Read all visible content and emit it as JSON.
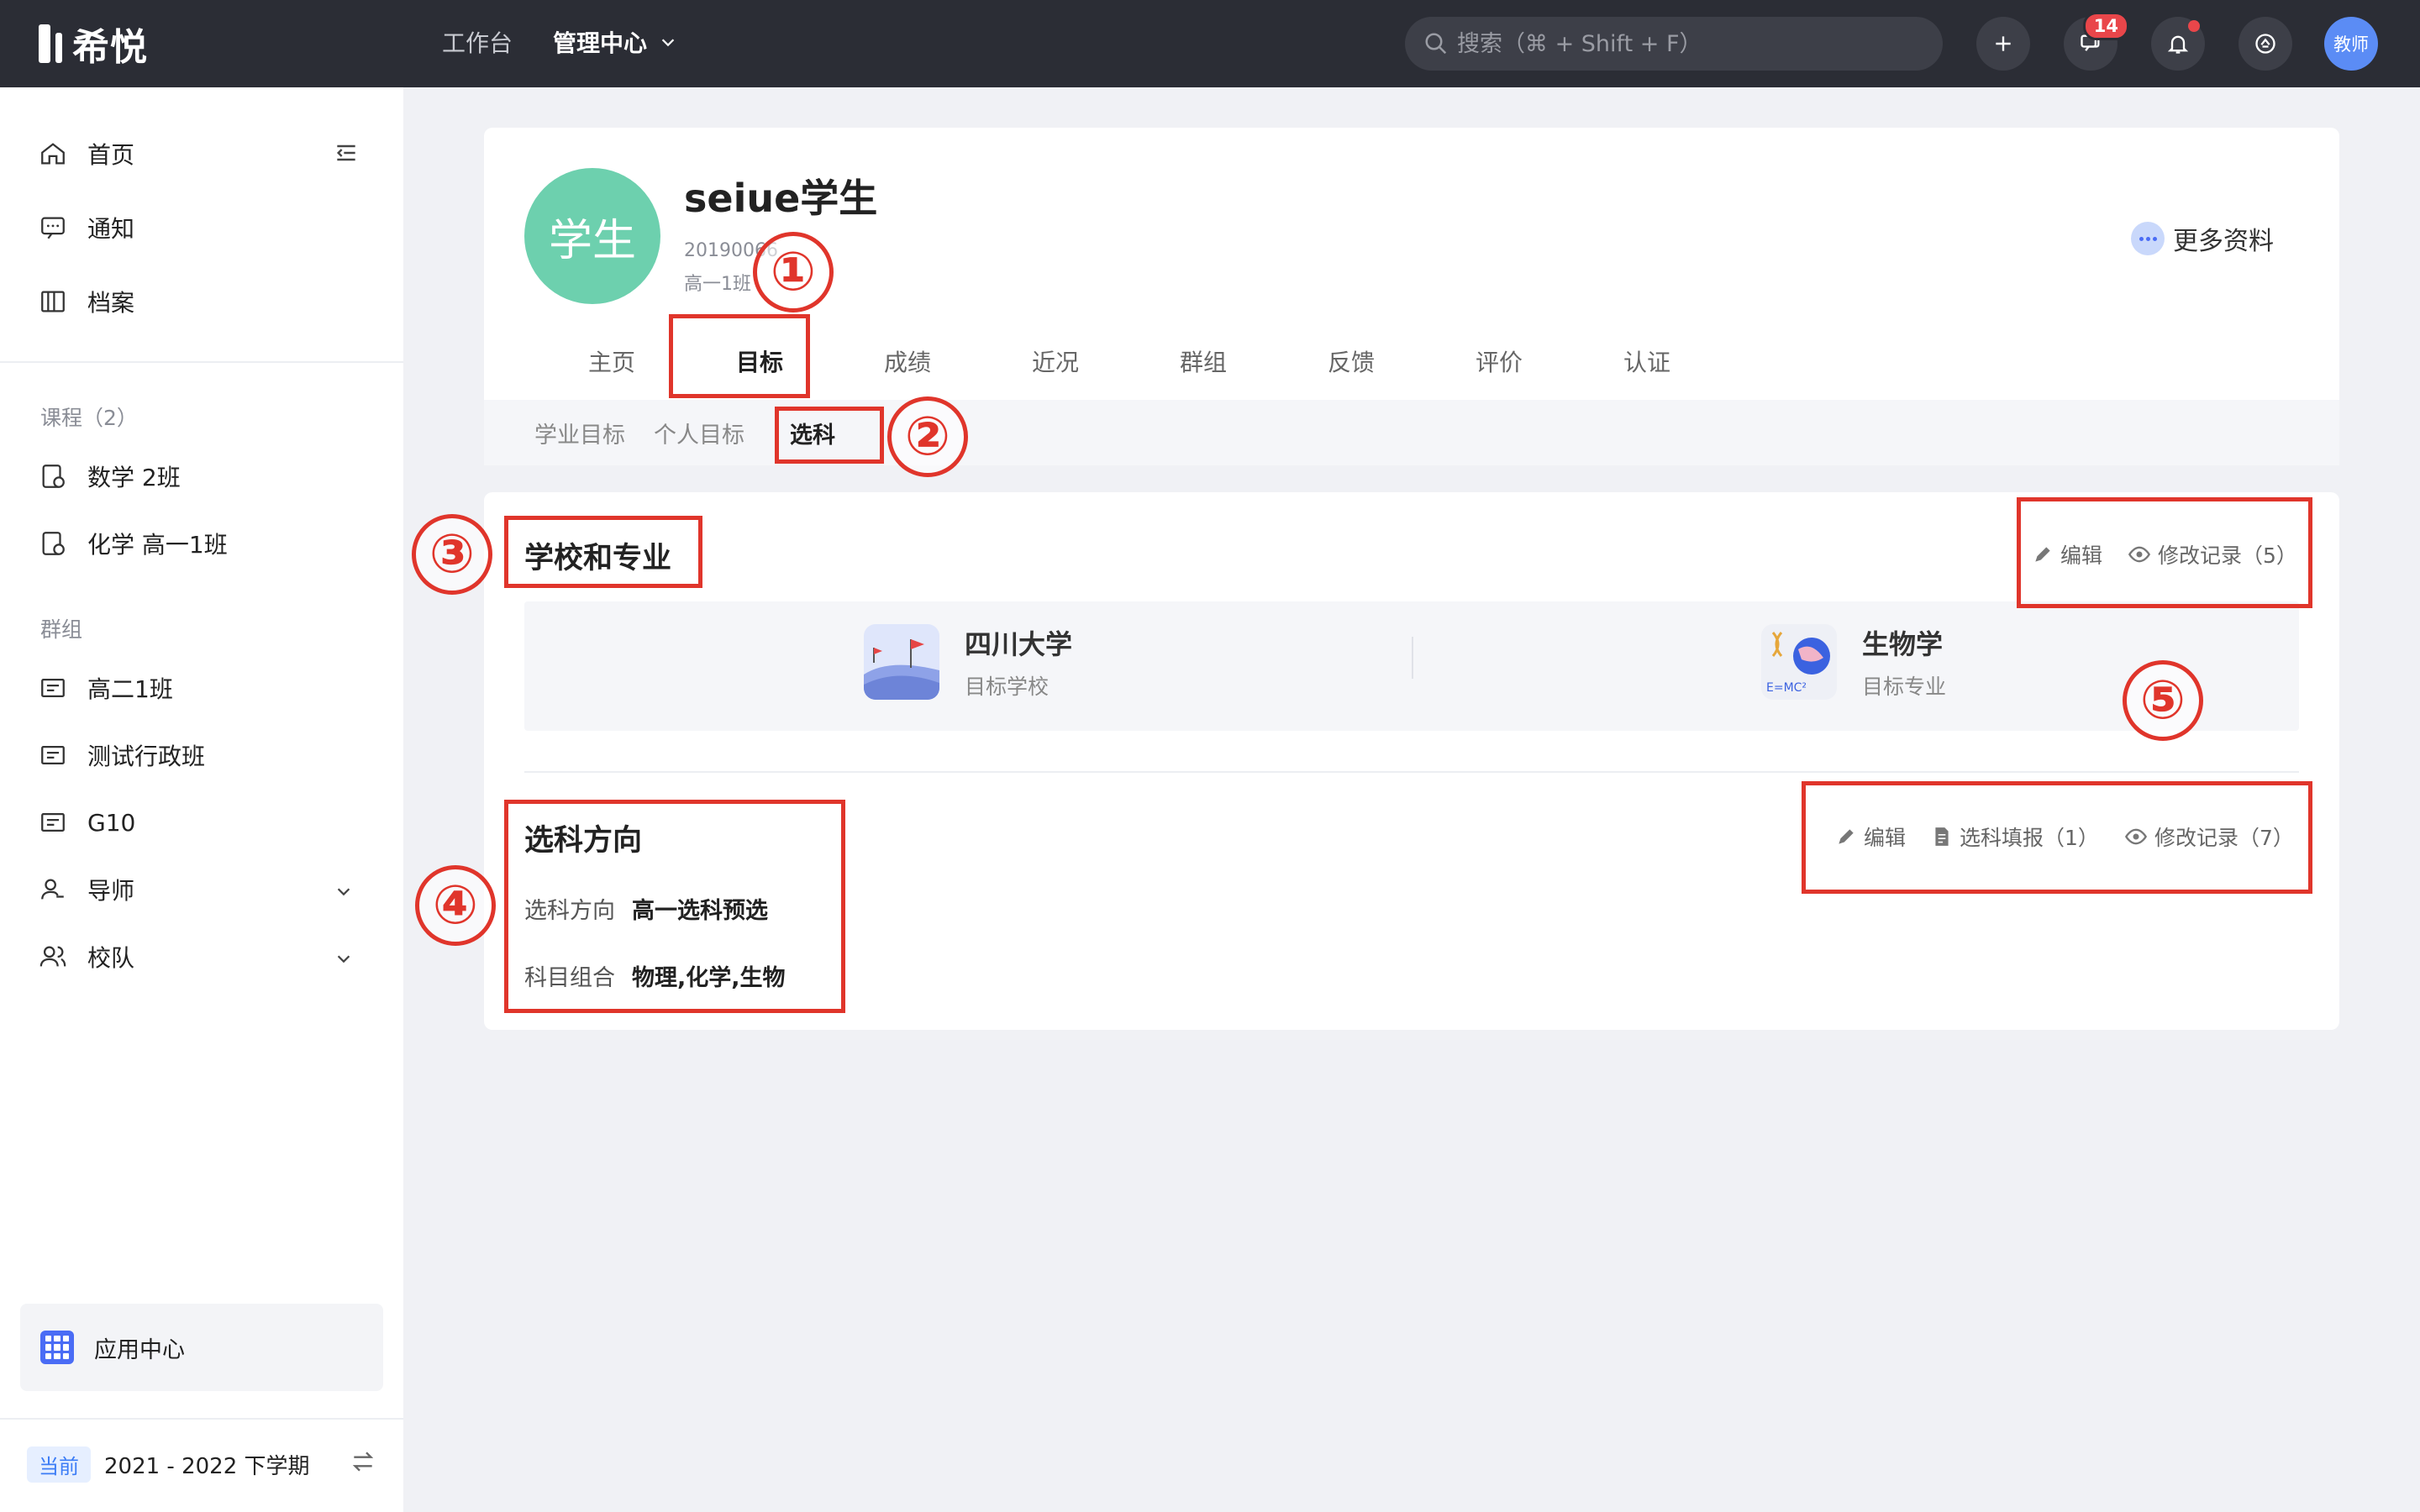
{
  "app": {
    "logo_text": "希悦"
  },
  "topnav": {
    "workbench": "工作台",
    "admin": "管理中心"
  },
  "search": {
    "placeholder": "搜索（⌘ + Shift + F）"
  },
  "topbar": {
    "message_count": "14",
    "avatar_label": "教师"
  },
  "sidebar": {
    "home": "首页",
    "notice": "通知",
    "archive": "档案",
    "courses_header": "课程（2）",
    "courses": [
      "数学 2班",
      "化学 高一1班"
    ],
    "groups_header": "群组",
    "groups": [
      "高二1班",
      "测试行政班",
      "G10"
    ],
    "mentor": "导师",
    "team": "校队",
    "app_center": "应用中心",
    "term_badge": "当前",
    "term": "2021 - 2022 下学期"
  },
  "profile": {
    "avatar_label": "学生",
    "name": "seiue学生",
    "id": "20190066",
    "class": "高一1班",
    "more": "更多资料",
    "tabs": [
      "主页",
      "目标",
      "成绩",
      "近况",
      "群组",
      "反馈",
      "评价",
      "认证"
    ],
    "active_tab": "目标",
    "subtabs": [
      "学业目标",
      "个人目标",
      "选科"
    ],
    "active_subtab": "选科"
  },
  "school_section": {
    "title": "学校和专业",
    "edit": "编辑",
    "history": "修改记录（5）",
    "school_name": "四川大学",
    "school_label": "目标学校",
    "major_name": "生物学",
    "major_label": "目标专业"
  },
  "subject_section": {
    "title": "选科方向",
    "edit": "编辑",
    "fill": "选科填报（1）",
    "history": "修改记录（7）",
    "direction_label": "选科方向",
    "direction_value": "高一选科预选",
    "combo_label": "科目组合",
    "combo_value": "物理,化学,生物"
  },
  "annotations": [
    "①",
    "②",
    "③",
    "④",
    "⑤"
  ],
  "colors": {
    "accent_red": "#e0352b",
    "avatar_green": "#6dd0ae",
    "brand_blue": "#4a6cf5",
    "topbar": "#2b2d35"
  }
}
